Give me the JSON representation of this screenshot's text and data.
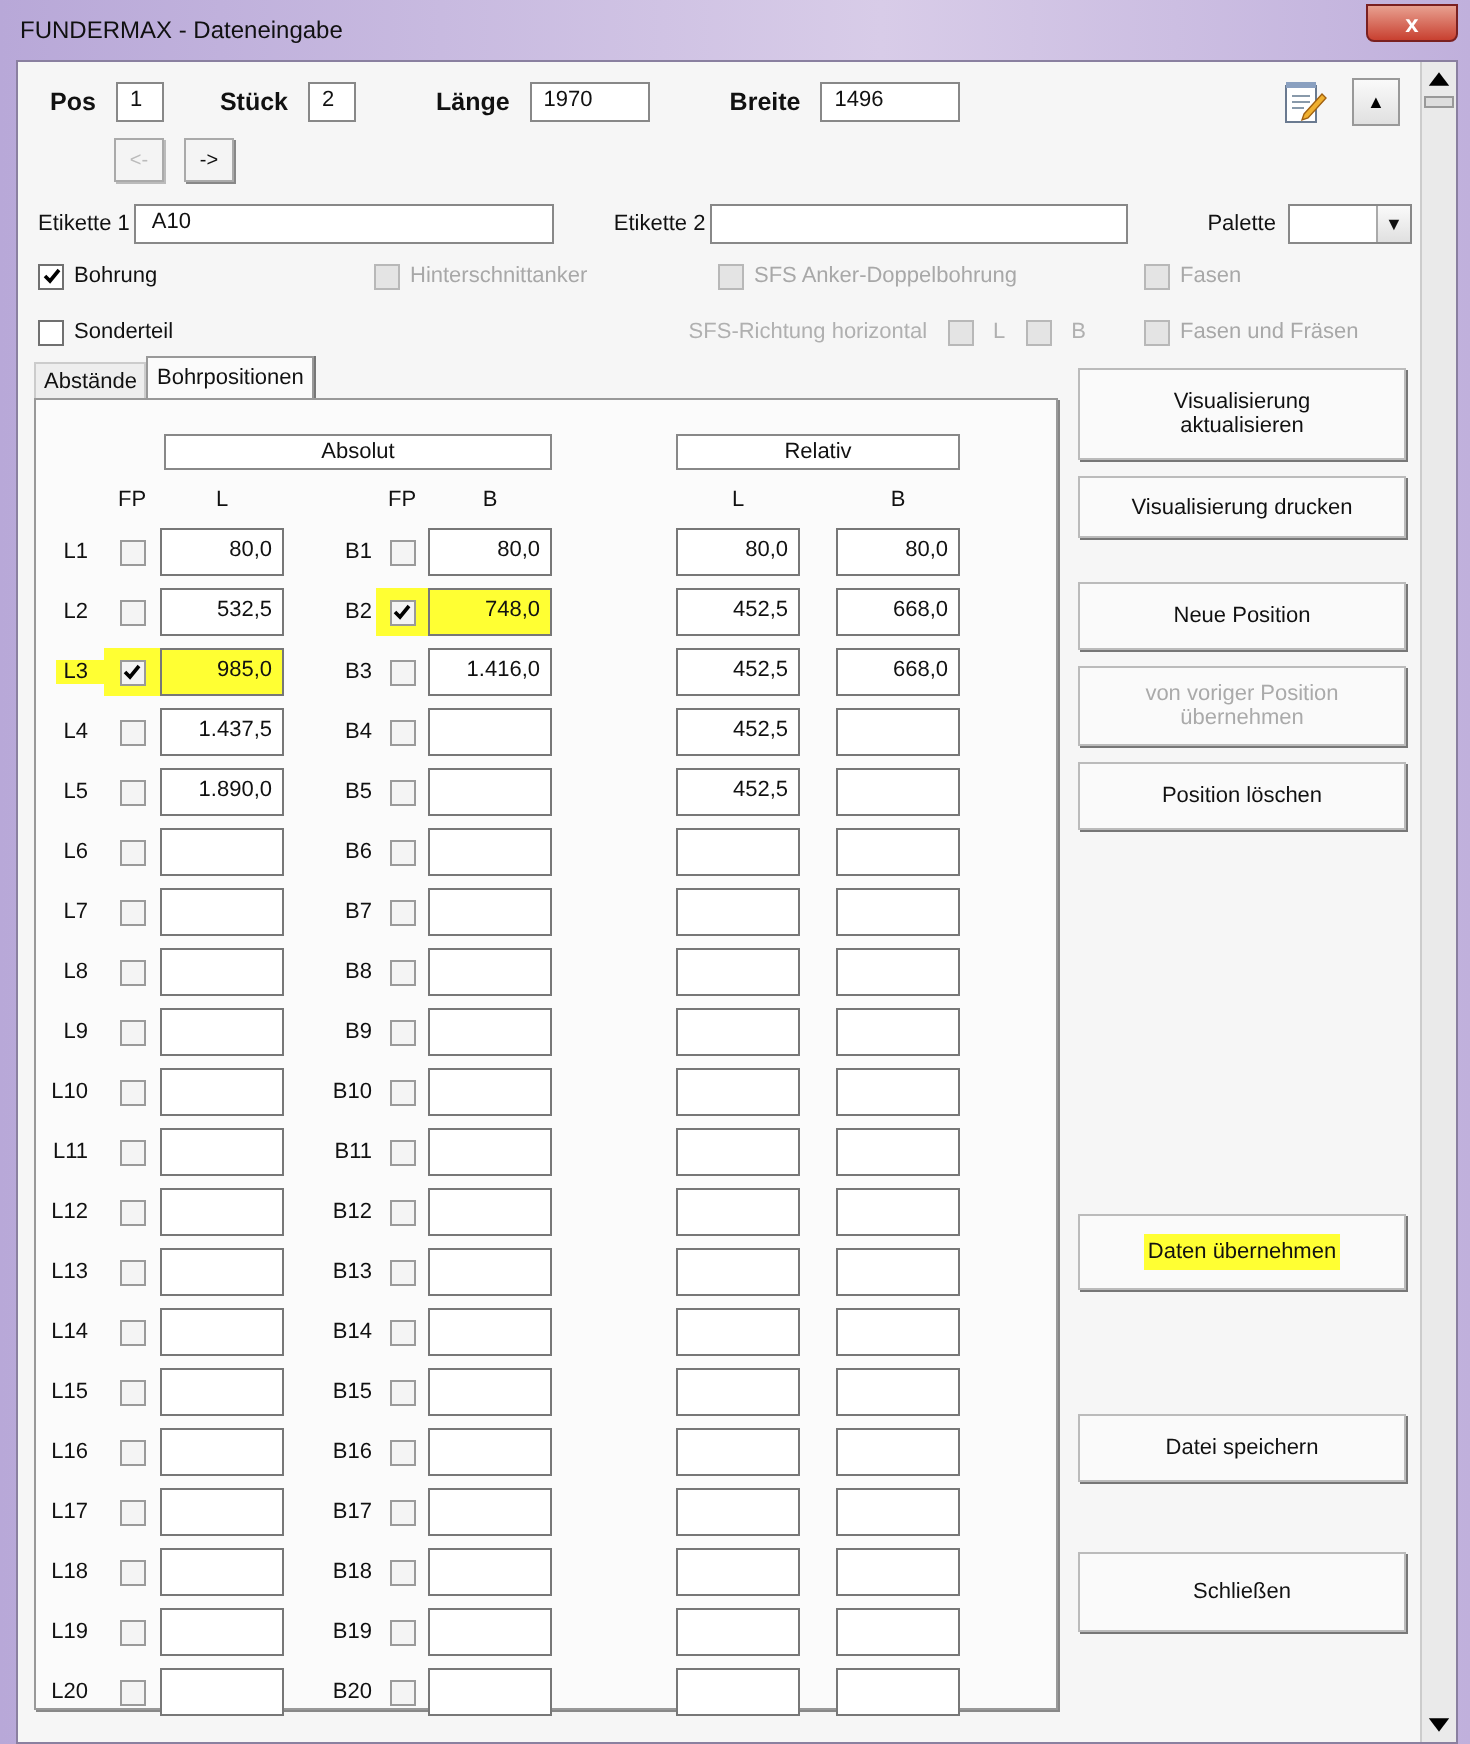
{
  "window": {
    "title": "FUNDERMAX - Dateneingabe",
    "close": "x"
  },
  "header_fields": [
    {
      "label": "Pos",
      "value": "1"
    },
    {
      "label": "Stück",
      "value": "2"
    },
    {
      "label": "Länge",
      "value": "1970"
    },
    {
      "label": "Breite",
      "value": "1496"
    }
  ],
  "up_button": "▲",
  "nav_buttons": [
    {
      "label": "<-",
      "disabled": true
    },
    {
      "label": "->",
      "disabled": false
    }
  ],
  "etikette_1": {
    "label": "Etikette 1",
    "value": "A10"
  },
  "etikette_2": {
    "label": "Etikette 2"
  },
  "palette": {
    "label": "Palette",
    "arrow": "▼"
  },
  "option_rows": [
    [
      {
        "kind": "checkbox",
        "label": "Bohrung",
        "checked": true,
        "disabled": false
      },
      {
        "kind": "checkbox",
        "label": "Hinterschnittanker",
        "checked": false,
        "disabled": true
      },
      {
        "kind": "checkbox",
        "label": "SFS Anker-Doppelbohrung",
        "checked": false,
        "disabled": true
      },
      {
        "kind": "checkbox",
        "label": "Fasen",
        "checked": false,
        "disabled": true
      }
    ],
    [
      {
        "kind": "checkbox",
        "label": "Sonderteil",
        "checked": false,
        "disabled": false
      },
      {
        "kind": "group",
        "label": "SFS-Richtung horizontal",
        "items": [
          {
            "label": "L",
            "checked": false,
            "disabled": true
          },
          {
            "label": "B",
            "checked": false,
            "disabled": true
          }
        ]
      },
      {
        "kind": "checkbox",
        "label": "Fasen und Fräsen",
        "checked": false,
        "disabled": true
      }
    ]
  ],
  "tabs": [
    {
      "label": "Abstände",
      "selected": false
    },
    {
      "label": "Bohrpositionen",
      "selected": true
    }
  ],
  "grid": {
    "absolut_header": "Absolut",
    "relativ_header": "Relativ",
    "columns": [
      "FP",
      "L",
      "FP",
      "B",
      "L",
      "B"
    ],
    "rows": [
      {
        "l_label": "L1",
        "l_fp": false,
        "l_value": "80,0",
        "l_highlighted": false,
        "b_label": "B1",
        "b_fp": false,
        "b_value": "80,0",
        "b_highlighted": false,
        "rel_l": "80,0",
        "rel_b": "80,0"
      },
      {
        "l_label": "L2",
        "l_fp": false,
        "l_value": "532,5",
        "l_highlighted": false,
        "b_label": "B2",
        "b_fp": true,
        "b_value": "748,0",
        "b_highlighted": true,
        "rel_l": "452,5",
        "rel_b": "668,0"
      },
      {
        "l_label": "L3",
        "l_fp": true,
        "l_value": "985,0",
        "l_highlighted": true,
        "b_label": "B3",
        "b_fp": false,
        "b_value": "1.416,0",
        "b_highlighted": false,
        "rel_l": "452,5",
        "rel_b": "668,0"
      },
      {
        "l_label": "L4",
        "l_fp": false,
        "l_value": "1.437,5",
        "l_highlighted": false,
        "b_label": "B4",
        "b_fp": false,
        "b_highlighted": false,
        "rel_l": "452,5"
      },
      {
        "l_label": "L5",
        "l_fp": false,
        "l_value": "1.890,0",
        "l_highlighted": false,
        "b_label": "B5",
        "b_fp": false,
        "b_highlighted": false,
        "rel_l": "452,5"
      },
      {
        "l_label": "L6",
        "l_fp": false,
        "l_highlighted": false,
        "b_label": "B6",
        "b_fp": false,
        "b_highlighted": false
      },
      {
        "l_label": "L7",
        "l_fp": false,
        "l_highlighted": false,
        "b_label": "B7",
        "b_fp": false,
        "b_highlighted": false
      },
      {
        "l_label": "L8",
        "l_fp": false,
        "l_highlighted": false,
        "b_label": "B8",
        "b_fp": false,
        "b_highlighted": false
      },
      {
        "l_label": "L9",
        "l_fp": false,
        "l_highlighted": false,
        "b_label": "B9",
        "b_fp": false,
        "b_highlighted": false
      },
      {
        "l_label": "L10",
        "l_fp": false,
        "l_highlighted": false,
        "b_label": "B10",
        "b_fp": false,
        "b_highlighted": false
      },
      {
        "l_label": "L11",
        "l_fp": false,
        "l_highlighted": false,
        "b_label": "B11",
        "b_fp": false,
        "b_highlighted": false
      },
      {
        "l_label": "L12",
        "l_fp": false,
        "l_highlighted": false,
        "b_label": "B12",
        "b_fp": false,
        "b_highlighted": false
      },
      {
        "l_label": "L13",
        "l_fp": false,
        "l_highlighted": false,
        "b_label": "B13",
        "b_fp": false,
        "b_highlighted": false
      },
      {
        "l_label": "L14",
        "l_fp": false,
        "l_highlighted": false,
        "b_label": "B14",
        "b_fp": false,
        "b_highlighted": false
      },
      {
        "l_label": "L15",
        "l_fp": false,
        "l_highlighted": false,
        "b_label": "B15",
        "b_fp": false,
        "b_highlighted": false
      },
      {
        "l_label": "L16",
        "l_fp": false,
        "l_highlighted": false,
        "b_label": "B16",
        "b_fp": false,
        "b_highlighted": false
      },
      {
        "l_label": "L17",
        "l_fp": false,
        "l_highlighted": false,
        "b_label": "B17",
        "b_fp": false,
        "b_highlighted": false
      },
      {
        "l_label": "L18",
        "l_fp": false,
        "l_highlighted": false,
        "b_label": "B18",
        "b_fp": false,
        "b_highlighted": false
      },
      {
        "l_label": "L19",
        "l_fp": false,
        "l_highlighted": false,
        "b_label": "B19",
        "b_fp": false,
        "b_highlighted": false
      },
      {
        "l_label": "L20",
        "l_fp": false,
        "l_highlighted": false,
        "b_label": "B20",
        "b_fp": false,
        "b_highlighted": false
      }
    ]
  },
  "buttons": [
    {
      "label": "Visualisierung aktualisieren",
      "disabled": false,
      "highlighted": false
    },
    {
      "label": "Visualisierung drucken",
      "disabled": false,
      "highlighted": false
    },
    {
      "label": "Neue Position",
      "disabled": false,
      "highlighted": false
    },
    {
      "label": "von voriger Position übernehmen",
      "disabled": true,
      "highlighted": false
    },
    {
      "label": "Position löschen",
      "disabled": false,
      "highlighted": false
    },
    {
      "label": "Daten übernehmen",
      "disabled": false,
      "highlighted": true
    },
    {
      "label": "Datei speichern",
      "disabled": false,
      "highlighted": false
    },
    {
      "label": "Schließen",
      "disabled": false,
      "highlighted": false
    }
  ]
}
